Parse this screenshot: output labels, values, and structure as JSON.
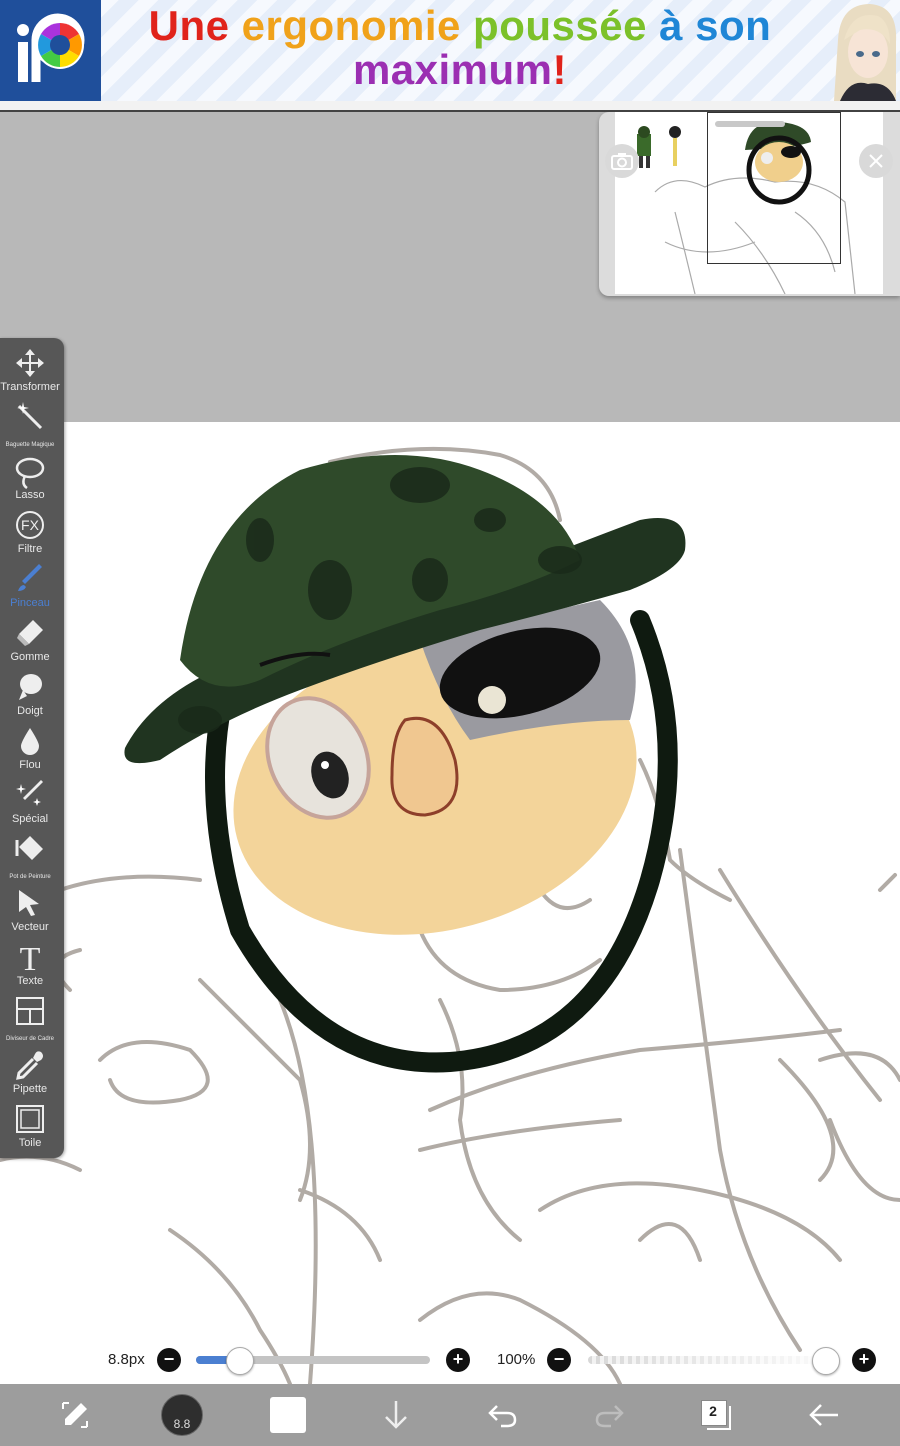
{
  "ad": {
    "title_words": [
      {
        "text": "Une ",
        "color": "#e0231b"
      },
      {
        "text": "ergonomie ",
        "color": "#f0a21a"
      },
      {
        "text": "poussée ",
        "color": "#7cc12a"
      },
      {
        "text": "à son",
        "color": "#1f86d6"
      },
      {
        "text": "maximum",
        "color": "#9b2fb2"
      },
      {
        "text": "!",
        "color": "#e0231b"
      }
    ],
    "logo_icon": "ibispaint-logo-icon"
  },
  "toolbar": {
    "tools": [
      {
        "name": "transform",
        "icon": "move-arrows-icon",
        "label": "Transformer"
      },
      {
        "name": "magic-wand",
        "icon": "magic-wand-icon",
        "label": "Baguette Magique"
      },
      {
        "name": "lasso",
        "icon": "lasso-icon",
        "label": "Lasso"
      },
      {
        "name": "filter",
        "icon": "fx-icon",
        "label": "Filtre"
      },
      {
        "name": "brush",
        "icon": "brush-icon",
        "label": "Pinceau",
        "active": true
      },
      {
        "name": "eraser",
        "icon": "eraser-icon",
        "label": "Gomme"
      },
      {
        "name": "smudge",
        "icon": "finger-icon",
        "label": "Doigt"
      },
      {
        "name": "blur",
        "icon": "droplet-icon",
        "label": "Flou"
      },
      {
        "name": "special",
        "icon": "sparkle-pen-icon",
        "label": "Spécial"
      },
      {
        "name": "bucket",
        "icon": "paint-bucket-icon",
        "label": "Pot de Peinture"
      },
      {
        "name": "vector",
        "icon": "cursor-icon",
        "label": "Vecteur"
      },
      {
        "name": "text",
        "icon": "text-icon",
        "label": "Texte"
      },
      {
        "name": "frame-divider",
        "icon": "frame-divider-icon",
        "label": "Diviseur de Cadre"
      },
      {
        "name": "eyedropper",
        "icon": "eyedropper-icon",
        "label": "Pipette"
      },
      {
        "name": "canvas",
        "icon": "canvas-icon",
        "label": "Toile"
      }
    ]
  },
  "brush": {
    "size_label": "8.8px",
    "size_fraction": 0.19,
    "opacity_label": "100%",
    "opacity_fraction": 1.0,
    "preview_value": "8.8"
  },
  "bottom_bar": {
    "layers_count": "2"
  },
  "colors": {
    "accent": "#4b7fd1",
    "toolbar_bg": "#575757",
    "bottombar_bg": "#9d9d9d",
    "workspace_bg": "#b8b8b8",
    "primary_color": "#ffffff"
  }
}
